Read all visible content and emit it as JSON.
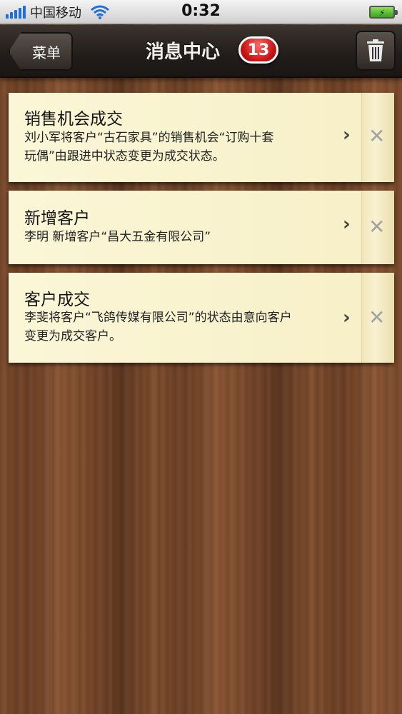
{
  "status_bar": {
    "carrier": "中国移动",
    "time": "0:32"
  },
  "nav": {
    "back_label": "菜单",
    "title": "消息中心",
    "badge_count": "13"
  },
  "messages": [
    {
      "title": "销售机会成交",
      "body_lines": [
        "刘小军将客户“古石家具”的销售机会“订购十套",
        "玩偶”由跟进中状态变更为成交状态。"
      ]
    },
    {
      "title": "新增客户",
      "body_lines": [
        "李明  新增客户“昌大五金有限公司”"
      ]
    },
    {
      "title": "客户成交",
      "body_lines": [
        "李斐将客户“飞鸽传媒有限公司”的状态由意向客户",
        "变更为成交客户。"
      ]
    }
  ],
  "colors": {
    "card_bg": "#fbf6d7",
    "nav_bg": "#231e1b",
    "badge_red": "#c20f0f",
    "signal_blue": "#1f6fd6",
    "battery_green": "#3aa21b"
  }
}
